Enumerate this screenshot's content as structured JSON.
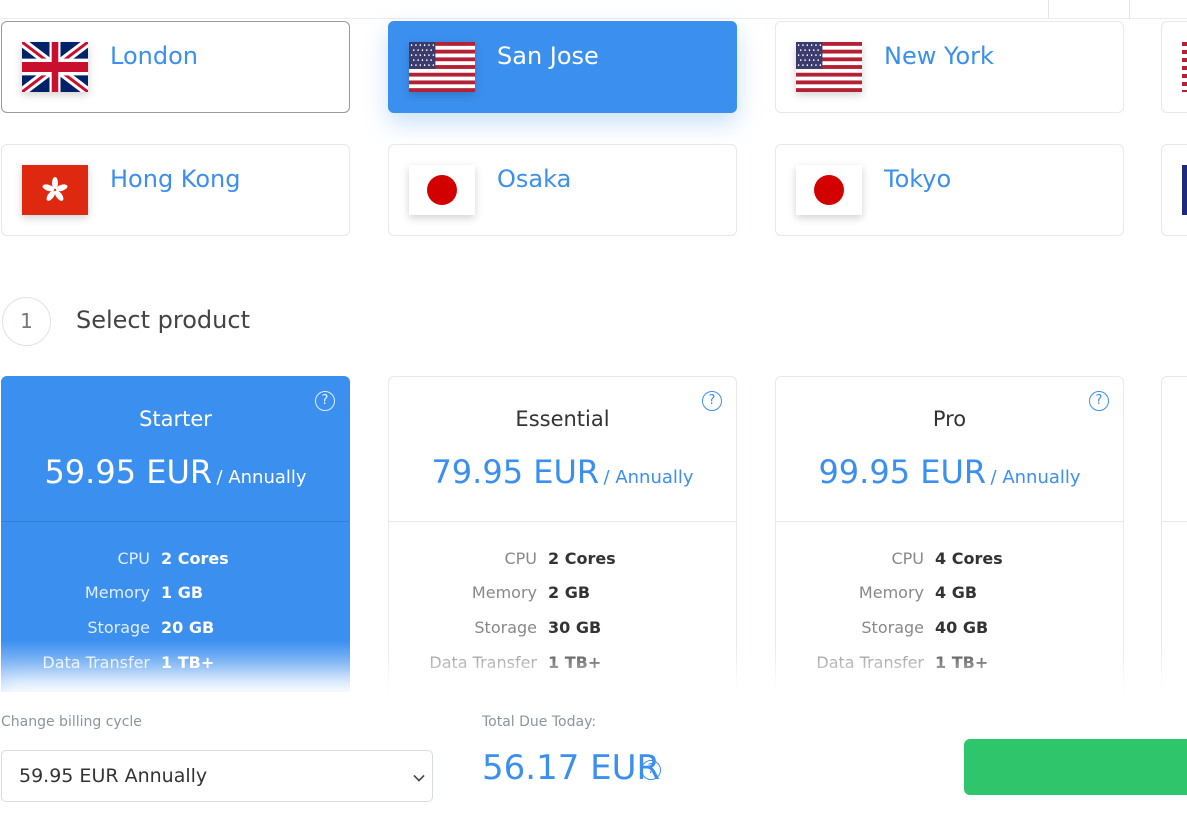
{
  "locations": [
    {
      "name": "London",
      "flag": "uk-flag"
    },
    {
      "name": "San Jose",
      "flag": "us-flag"
    },
    {
      "name": "New York",
      "flag": "us-flag"
    },
    {
      "name": "Hong Kong",
      "flag": "hk-flag"
    },
    {
      "name": "Osaka",
      "flag": "jp-flag"
    },
    {
      "name": "Tokyo",
      "flag": "jp-flag"
    }
  ],
  "selected_location": "San Jose",
  "step": {
    "number": "1",
    "title": "Select product"
  },
  "products": [
    {
      "name": "Starter",
      "price": "59.95 EUR",
      "cycle": "/ Annually",
      "help": "?",
      "specs": [
        {
          "k": "CPU",
          "v": "2 Cores"
        },
        {
          "k": "Memory",
          "v": "1 GB"
        },
        {
          "k": "Storage",
          "v": "20 GB"
        },
        {
          "k": "Data Transfer",
          "v": "1 TB+"
        }
      ]
    },
    {
      "name": "Essential",
      "price": "79.95 EUR",
      "cycle": "/ Annually",
      "help": "?",
      "specs": [
        {
          "k": "CPU",
          "v": "2 Cores"
        },
        {
          "k": "Memory",
          "v": "2 GB"
        },
        {
          "k": "Storage",
          "v": "30 GB"
        },
        {
          "k": "Data Transfer",
          "v": "1 TB+"
        }
      ]
    },
    {
      "name": "Pro",
      "price": "99.95 EUR",
      "cycle": "/ Annually",
      "help": "?",
      "specs": [
        {
          "k": "CPU",
          "v": "4 Cores"
        },
        {
          "k": "Memory",
          "v": "4 GB"
        },
        {
          "k": "Storage",
          "v": "40 GB"
        },
        {
          "k": "Data Transfer",
          "v": "1 TB+"
        }
      ]
    }
  ],
  "selected_product": "Starter",
  "footer": {
    "billing_label": "Change billing cycle",
    "billing_value": "59.95 EUR Annually",
    "due_label": "Total Due Today:",
    "due_amount": "56.17 EUR",
    "due_help": "?"
  },
  "colors": {
    "accent": "#3b8fef",
    "cta": "#2ec56b"
  }
}
